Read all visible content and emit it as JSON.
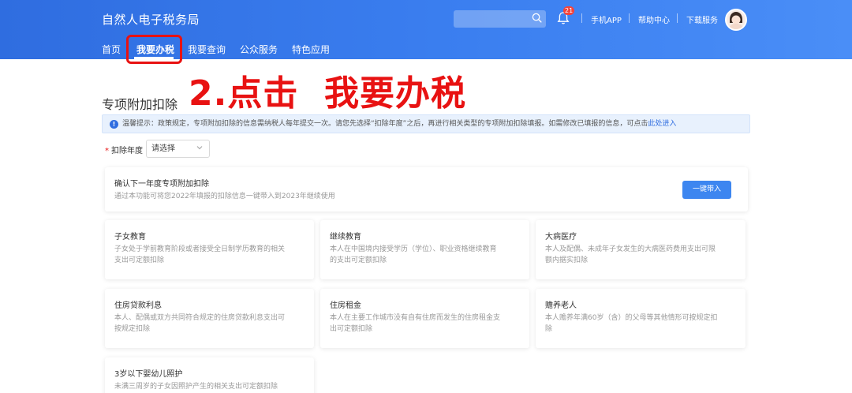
{
  "header": {
    "site_title": "自然人电子税务局",
    "search_placeholder": "",
    "notification_count": "21",
    "links": [
      "手机APP",
      "帮助中心",
      "下载服务"
    ]
  },
  "nav": {
    "items": [
      "首页",
      "我要办税",
      "我要查询",
      "公众服务",
      "特色应用"
    ],
    "active": "我要办税"
  },
  "annotation": {
    "text": "2.点击  我要办税",
    "color": "#e81212"
  },
  "page": {
    "title": "专项附加扣除",
    "notice": {
      "text": "温馨提示：政策规定，专项附加扣除的信息需纳税人每年提交一次。请您先选择“扣除年度”之后，再进行相关类型的专项附加扣除填报。如需修改已填报的信息，可点击",
      "link": "此处进入"
    },
    "year_field": {
      "required_mark": "*",
      "label": "扣除年度",
      "value": "请选择"
    },
    "confirm_card": {
      "title": "确认下一年度专项附加扣除",
      "desc": "通过本功能可将您2022年填报的扣除信息一键带入到2023年继续使用",
      "button": "一键带入"
    },
    "categories": [
      {
        "title": "子女教育",
        "desc1": "子女处于学前教育阶段或者接受全日制学历教育的相关",
        "desc2": "支出可定额扣除"
      },
      {
        "title": "继续教育",
        "desc1": "本人在中国境内接受学历（学位）、职业资格继续教育",
        "desc2": "的支出可定额扣除"
      },
      {
        "title": "大病医疗",
        "desc1": "本人及配偶、未成年子女发生的大病医药费用支出可限",
        "desc2": "额内据实扣除"
      },
      {
        "title": "住房贷款利息",
        "desc1": "本人、配偶或双方共同符合规定的住房贷款利息支出可",
        "desc2": "按规定扣除"
      },
      {
        "title": "住房租金",
        "desc1": "本人在主要工作城市没有自有住房而发生的住房租金支",
        "desc2": "出可定额扣除"
      },
      {
        "title": "赡养老人",
        "desc1": "本人赡养年满60岁（含）的父母等其他情形可按规定扣",
        "desc2": "除"
      },
      {
        "title": "3岁以下婴幼儿照护",
        "desc1": "未满三周岁的子女因照护产生的相关支出可定额扣除",
        "desc2": ""
      }
    ]
  },
  "colors": {
    "brand_blue": "#2f6de0",
    "button_blue": "#3d86f0",
    "annotation_red": "#e81212"
  }
}
